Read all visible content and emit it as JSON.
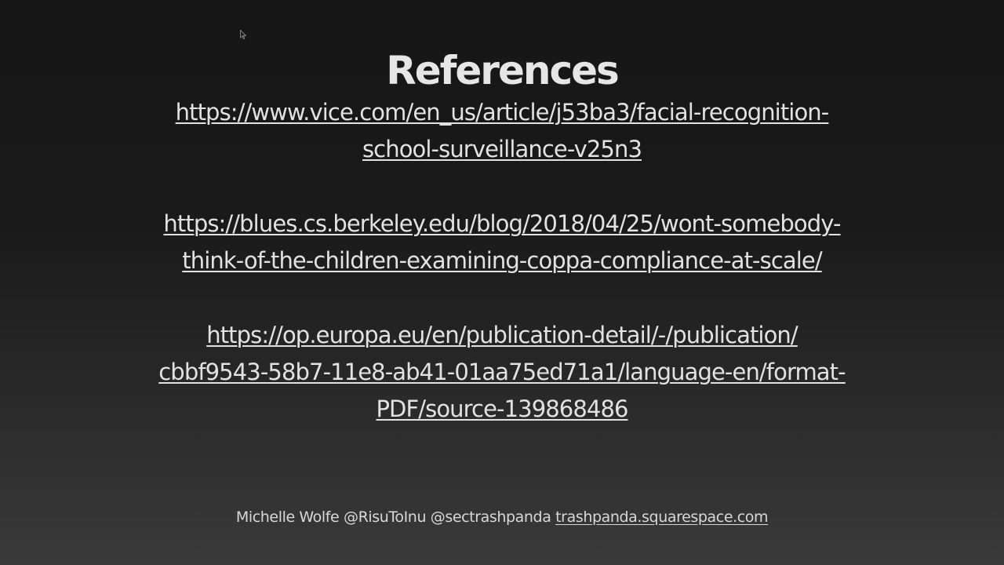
{
  "slide": {
    "title": "References",
    "references": [
      {
        "lines": [
          "https://www.vice.com/en_us/article/j53ba3/facial-recognition-",
          "school-surveillance-v25n3"
        ]
      },
      {
        "lines": [
          "https://blues.cs.berkeley.edu/blog/2018/04/25/wont-somebody-",
          "think-of-the-children-examining-coppa-compliance-at-scale/"
        ]
      },
      {
        "lines": [
          "https://op.europa.eu/en/publication-detail/-/publication/",
          "cbbf9543-58b7-11e8-ab41-01aa75ed71a1/language-en/format-",
          "PDF/source-139868486"
        ]
      }
    ],
    "footer": {
      "credits": "Michelle Wolfe @RisuToInu @sectrashpanda ",
      "site": "trashpanda.squarespace.com"
    }
  },
  "icons": {
    "cursor": "mouse-pointer-icon"
  },
  "colors": {
    "text": "#e2e2e2",
    "background_top": "#161616",
    "background_bottom": "#3a3a3a"
  }
}
